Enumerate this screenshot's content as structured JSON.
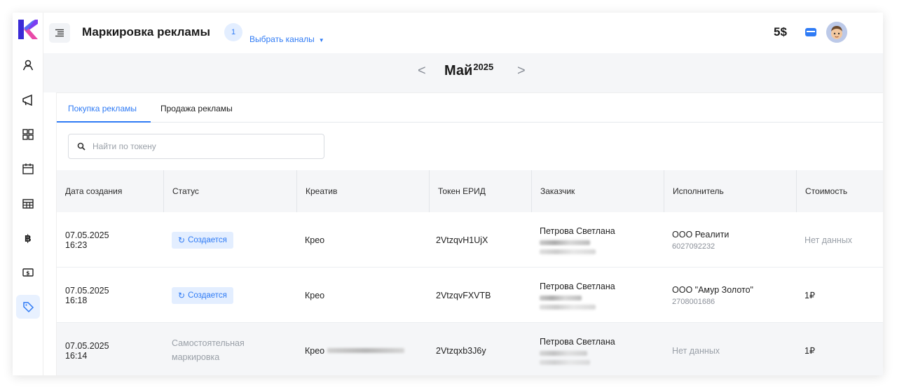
{
  "header": {
    "title": "Маркировка рекламы",
    "channel_count": "1",
    "channels_label": "Выбрать каналы",
    "balance": "5$"
  },
  "month": {
    "name": "Май",
    "year": "2025",
    "prev": "<",
    "next": ">"
  },
  "tabs": [
    "Покупка рекламы",
    "Продажа рекламы"
  ],
  "search": {
    "placeholder": "Найти по токену"
  },
  "table": {
    "columns": [
      "Дата создания",
      "Статус",
      "Креатив",
      "Токен ЕРИД",
      "Заказчик",
      "Исполнитель",
      "Стоимость"
    ],
    "rows": [
      {
        "date": "07.05.2025",
        "time": "16:23",
        "status": "Создается",
        "creative": "Крео",
        "token": "2VtzqvH1UjX",
        "customer": "Петрова Светлана",
        "executor": "ООО Реалити",
        "executor_inn": "6027092232",
        "cost": "Нет данных"
      },
      {
        "date": "07.05.2025",
        "time": "16:18",
        "status": "Создается",
        "creative": "Крео",
        "token": "2VtzqvFXVTB",
        "customer": "Петрова Светлана",
        "executor": "ООО \"Амур Золото\"",
        "executor_inn": "2708001686",
        "cost": "1₽"
      },
      {
        "date": "07.05.2025",
        "time": "16:14",
        "status": "Самостоятельная маркировка",
        "creative": "Крео",
        "token": "2Vtzqxb3J6y",
        "customer": "Петрова Светлана",
        "executor": "Нет данных",
        "executor_inn": "",
        "cost": "1₽"
      }
    ]
  },
  "colors": {
    "accent": "#2f7bf5",
    "badge_bg": "#e3eeff",
    "muted": "#9aa0a8"
  },
  "icons": [
    "logo-icon",
    "user-icon",
    "megaphone-icon",
    "grid-icon",
    "calendar-icon",
    "table-icon",
    "bitcoin-icon",
    "cash-icon",
    "tag-icon",
    "menu-icon",
    "wallet-icon",
    "search-icon",
    "refresh-icon"
  ]
}
